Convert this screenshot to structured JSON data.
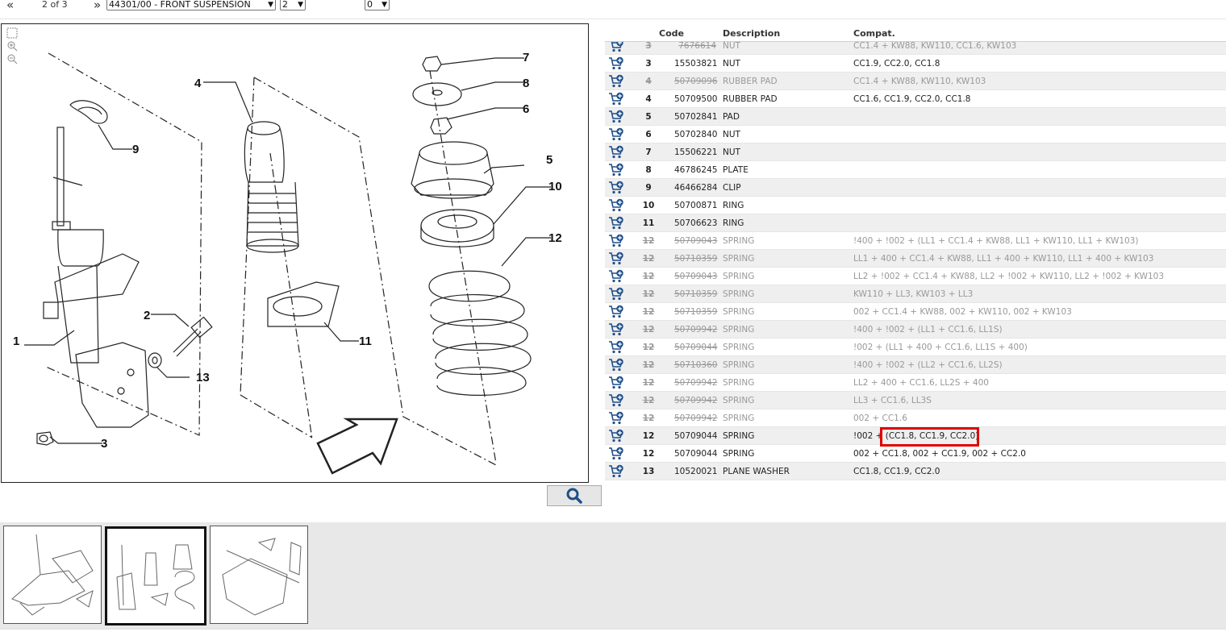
{
  "nav": {
    "first_glyph": "«",
    "page_label": "2 of 3",
    "next_glyph": "»",
    "group_select": "44301/00 - FRONT SUSPENSION",
    "page_select": "2",
    "qty_select": "0"
  },
  "drawing": {
    "callouts": [
      "1",
      "2",
      "3",
      "4",
      "5",
      "6",
      "7",
      "8",
      "9",
      "10",
      "11",
      "12",
      "13"
    ]
  },
  "table": {
    "headers": {
      "code": "Code",
      "description": "Description",
      "compat": "Compat."
    },
    "rows": [
      {
        "num": "3",
        "code": "7676614",
        "desc": "NUT",
        "compat": "CC1.4 + KW88, KW110, CC1.6, KW103",
        "old": true
      },
      {
        "num": "3",
        "code": "15503821",
        "desc": "NUT",
        "compat": "CC1.9, CC2.0, CC1.8",
        "old": false
      },
      {
        "num": "4",
        "code": "50709096",
        "desc": "RUBBER PAD",
        "compat": "CC1.4 + KW88, KW110, KW103",
        "old": true
      },
      {
        "num": "4",
        "code": "50709500",
        "desc": "RUBBER PAD",
        "compat": "CC1.6, CC1.9, CC2.0, CC1.8",
        "old": false
      },
      {
        "num": "5",
        "code": "50702841",
        "desc": "PAD",
        "compat": "",
        "old": false
      },
      {
        "num": "6",
        "code": "50702840",
        "desc": "NUT",
        "compat": "",
        "old": false
      },
      {
        "num": "7",
        "code": "15506221",
        "desc": "NUT",
        "compat": "",
        "old": false
      },
      {
        "num": "8",
        "code": "46786245",
        "desc": "PLATE",
        "compat": "",
        "old": false
      },
      {
        "num": "9",
        "code": "46466284",
        "desc": "CLIP",
        "compat": "",
        "old": false
      },
      {
        "num": "10",
        "code": "50700871",
        "desc": "RING",
        "compat": "",
        "old": false
      },
      {
        "num": "11",
        "code": "50706623",
        "desc": "RING",
        "compat": "",
        "old": false
      },
      {
        "num": "12",
        "code": "50709043",
        "desc": "SPRING",
        "compat": "!400 + !002 + (LL1 + CC1.4 + KW88, LL1 + KW110, LL1 + KW103)",
        "old": true
      },
      {
        "num": "12",
        "code": "50710359",
        "desc": "SPRING",
        "compat": "LL1 + 400 + CC1.4 + KW88, LL1 + 400 + KW110, LL1 + 400 + KW103",
        "old": true
      },
      {
        "num": "12",
        "code": "50709043",
        "desc": "SPRING",
        "compat": "LL2 + !002 + CC1.4 + KW88, LL2 + !002 + KW110, LL2 + !002 + KW103",
        "old": true
      },
      {
        "num": "12",
        "code": "50710359",
        "desc": "SPRING",
        "compat": "KW110 + LL3, KW103 + LL3",
        "old": true
      },
      {
        "num": "12",
        "code": "50710359",
        "desc": "SPRING",
        "compat": "002 + CC1.4 + KW88, 002 + KW110, 002 + KW103",
        "old": true
      },
      {
        "num": "12",
        "code": "50709942",
        "desc": "SPRING",
        "compat": "!400 + !002 + (LL1 + CC1.6, LL1S)",
        "old": true
      },
      {
        "num": "12",
        "code": "50709044",
        "desc": "SPRING",
        "compat": "!002 + (LL1 + 400 + CC1.6, LL1S + 400)",
        "old": true
      },
      {
        "num": "12",
        "code": "50710360",
        "desc": "SPRING",
        "compat": "!400 + !002 + (LL2 + CC1.6, LL2S)",
        "old": true
      },
      {
        "num": "12",
        "code": "50709942",
        "desc": "SPRING",
        "compat": "LL2 + 400 + CC1.6, LL2S + 400",
        "old": true
      },
      {
        "num": "12",
        "code": "50709942",
        "desc": "SPRING",
        "compat": "LL3 + CC1.6, LL3S",
        "old": true
      },
      {
        "num": "12",
        "code": "50709942",
        "desc": "SPRING",
        "compat": "002 + CC1.6",
        "old": true
      },
      {
        "num": "12",
        "code": "50709044",
        "desc": "SPRING",
        "compat": "!002 + (CC1.8, CC1.9, CC2.0)",
        "old": false
      },
      {
        "num": "12",
        "code": "50709044",
        "desc": "SPRING",
        "compat": "002 + CC1.8, 002 + CC1.9, 002 + CC2.0",
        "old": false
      },
      {
        "num": "13",
        "code": "10520021",
        "desc": "PLANE WASHER",
        "compat": "CC1.8, CC1.9, CC2.0",
        "old": false
      }
    ]
  },
  "colors": {
    "highlight": "#e00000",
    "cart_icon": "#1f4f8a",
    "old_text": "#999999"
  },
  "icons": [
    "pointer-icon",
    "zoom-in-icon",
    "zoom-out-icon",
    "cart-add-icon",
    "search-icon"
  ]
}
